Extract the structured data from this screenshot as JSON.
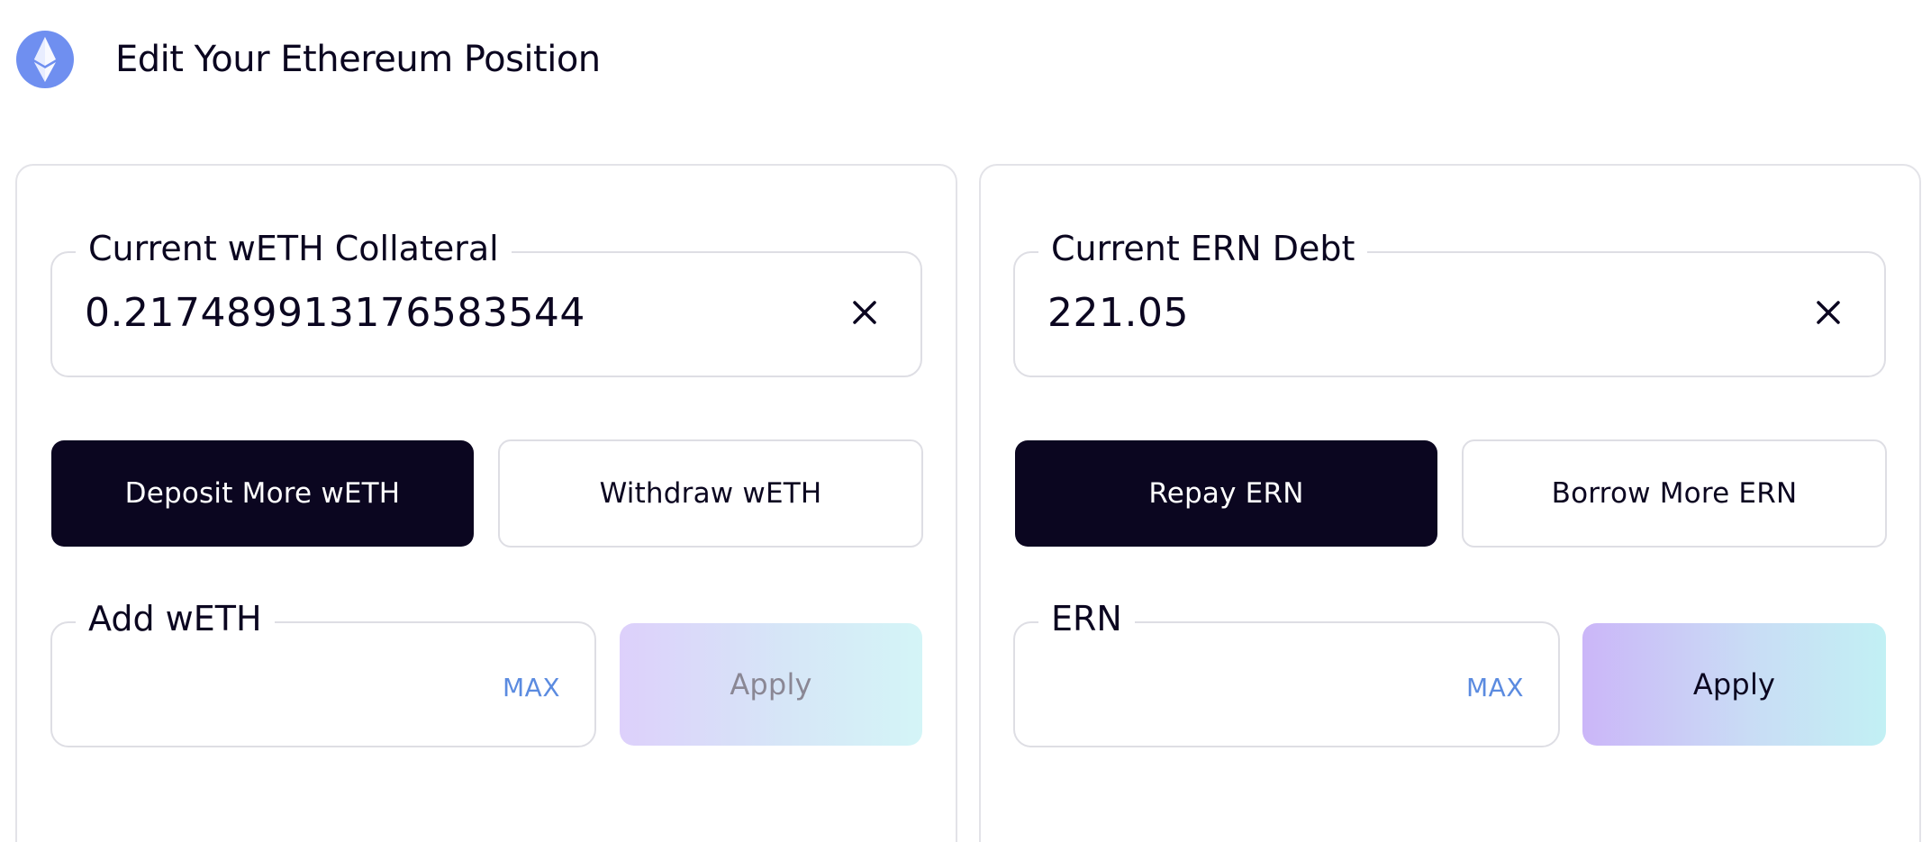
{
  "header": {
    "title": "Edit Your Ethereum Position",
    "icon": "ethereum-icon"
  },
  "collateral": {
    "label": "Current wETH Collateral",
    "value": "0.217489913176583544",
    "deposit_label": "Deposit More wETH",
    "withdraw_label": "Withdraw wETH",
    "amount_label": "Add wETH",
    "max_label": "MAX",
    "apply_label": "Apply"
  },
  "debt": {
    "label": "Current ERN Debt",
    "value": "221.05",
    "repay_label": "Repay ERN",
    "borrow_label": "Borrow More ERN",
    "amount_label": "ERN",
    "max_label": "MAX",
    "apply_label": "Apply"
  },
  "colors": {
    "primary_dark": "#0b0620",
    "accent_link": "#5b8be0",
    "eth_logo": "#6f8ff0"
  }
}
